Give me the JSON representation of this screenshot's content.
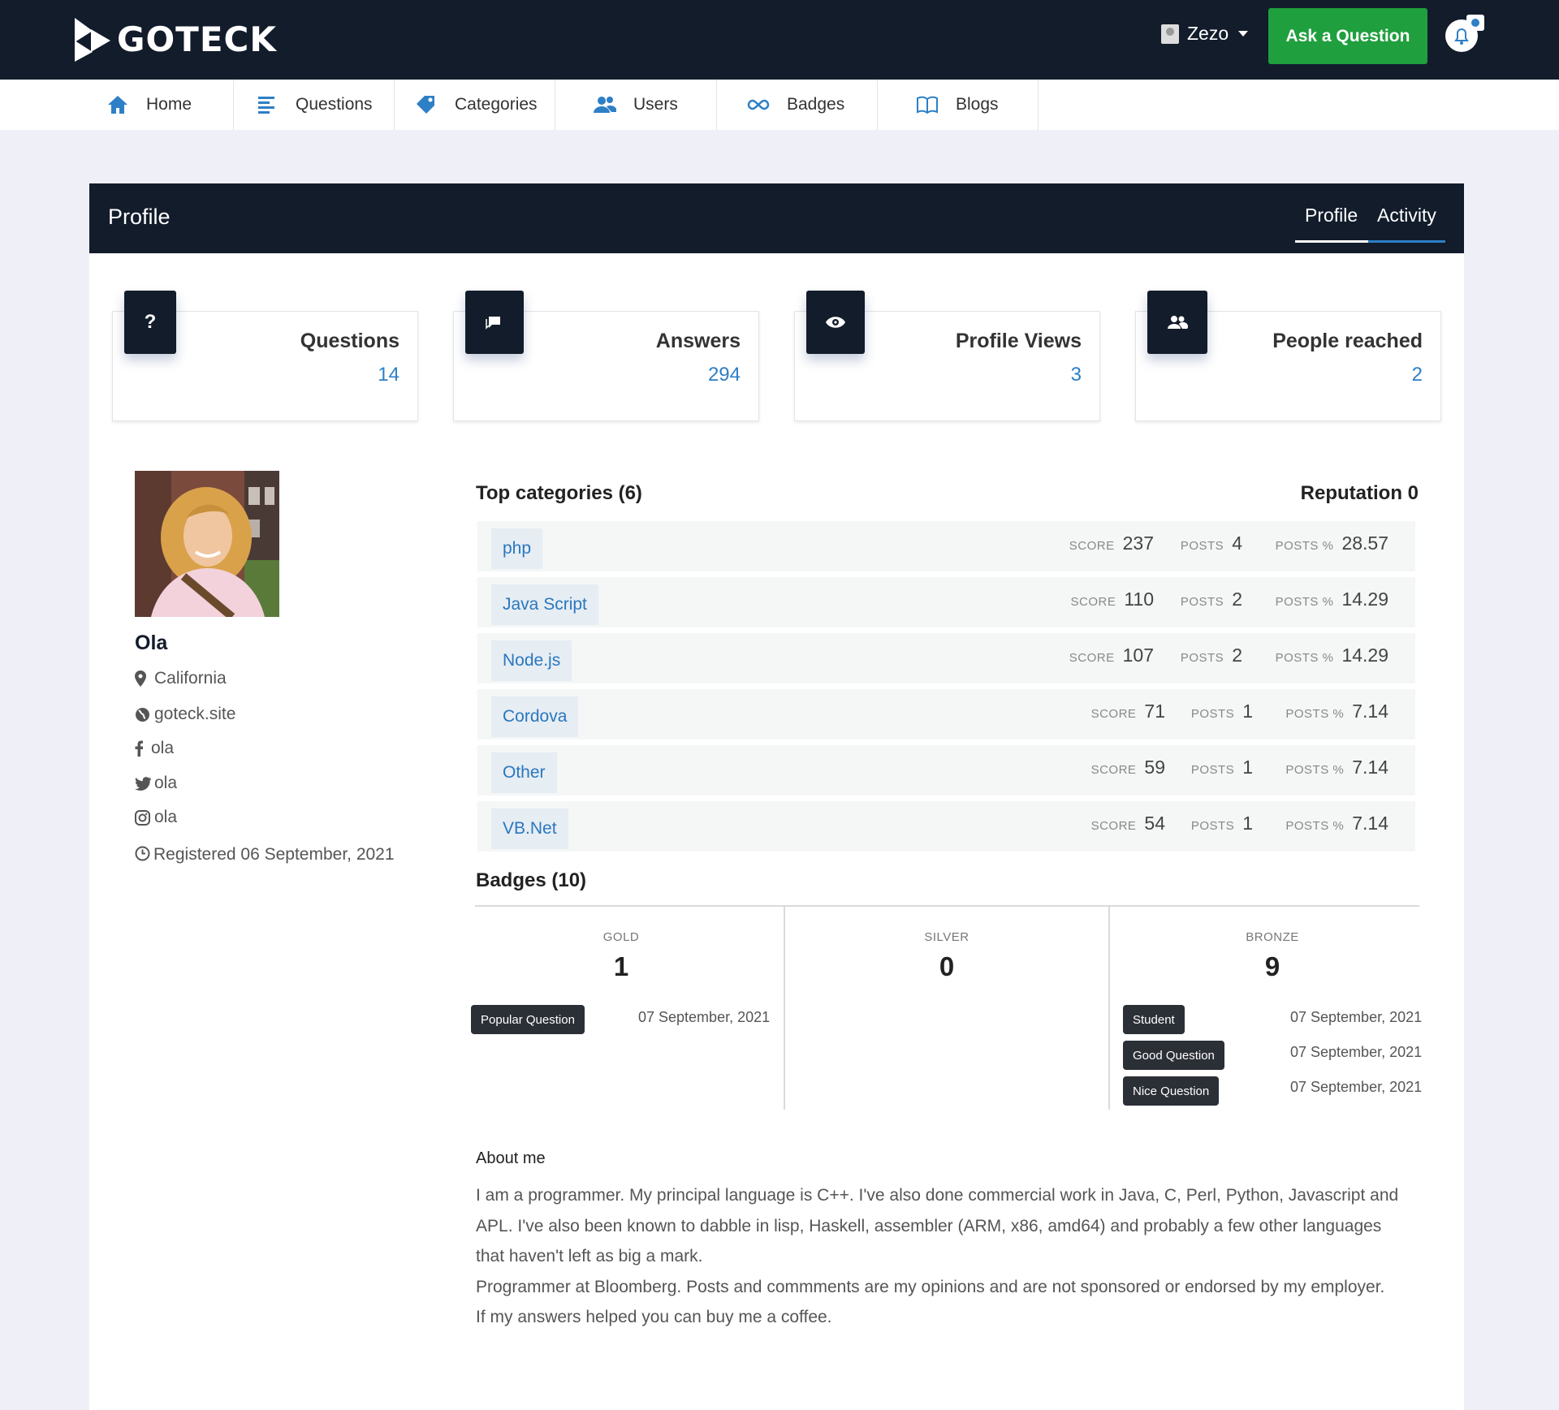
{
  "brand": {
    "name": "GOTECK"
  },
  "header": {
    "user_name": "Zezo",
    "ask_button": "Ask a Question",
    "icons": {
      "user": "user-avatar-icon",
      "dropdown": "chevron-down-icon",
      "notifications": "bell-icon"
    }
  },
  "nav": {
    "items": [
      {
        "label": "Home",
        "icon": "home-icon"
      },
      {
        "label": "Questions",
        "icon": "list-icon"
      },
      {
        "label": "Categories",
        "icon": "tag-icon"
      },
      {
        "label": "Users",
        "icon": "users-icon"
      },
      {
        "label": "Badges",
        "icon": "infinity-icon"
      },
      {
        "label": "Blogs",
        "icon": "book-icon"
      }
    ]
  },
  "profile_header": {
    "title": "Profile",
    "tabs": [
      {
        "label": "Profile",
        "active": true
      },
      {
        "label": "Activity",
        "active": false
      }
    ]
  },
  "stats": [
    {
      "label": "Questions",
      "value": "14",
      "icon": "question-icon"
    },
    {
      "label": "Answers",
      "value": "294",
      "icon": "chat-icon"
    },
    {
      "label": "Profile Views",
      "value": "3",
      "icon": "eye-icon"
    },
    {
      "label": "People reached",
      "value": "2",
      "icon": "people-icon"
    }
  ],
  "user": {
    "name": "Ola",
    "location": "California",
    "website": "goteck.site",
    "facebook": "ola",
    "twitter": "ola",
    "instagram": "ola",
    "registered": "Registered 06 September, 2021"
  },
  "categories": {
    "title": "Top categories (6)",
    "reputation": "Reputation 0",
    "labels": {
      "score": "SCORE",
      "posts": "POSTS",
      "posts_pct": "POSTS %"
    },
    "rows": [
      {
        "name": "php",
        "score": "237",
        "posts": "4",
        "posts_pct": "28.57"
      },
      {
        "name": "Java Script",
        "score": "110",
        "posts": "2",
        "posts_pct": "14.29"
      },
      {
        "name": "Node.js",
        "score": "107",
        "posts": "2",
        "posts_pct": "14.29"
      },
      {
        "name": "Cordova",
        "score": "71",
        "posts": "1",
        "posts_pct": "7.14"
      },
      {
        "name": "Other",
        "score": "59",
        "posts": "1",
        "posts_pct": "7.14"
      },
      {
        "name": "VB.Net",
        "score": "54",
        "posts": "1",
        "posts_pct": "7.14"
      }
    ]
  },
  "badges": {
    "title": "Badges (10)",
    "gold": {
      "label": "GOLD",
      "count": "1",
      "items": [
        {
          "name": "Popular Question",
          "date": "07 September, 2021"
        }
      ]
    },
    "silver": {
      "label": "SILVER",
      "count": "0",
      "items": []
    },
    "bronze": {
      "label": "BRONZE",
      "count": "9",
      "items": [
        {
          "name": "Student",
          "date": "07 September, 2021"
        },
        {
          "name": "Good Question",
          "date": "07 September, 2021"
        },
        {
          "name": "Nice Question",
          "date": "07 September, 2021"
        }
      ]
    }
  },
  "about": {
    "title": "About me",
    "lines": [
      "I am a programmer. My principal language is C++. I've also done commercial work in Java, C, Perl, Python, Javascript and APL. I've also been known to dabble in lisp, Haskell, assembler (ARM, x86, amd64) and probably a few other languages that haven't left as big a mark.",
      "Programmer at Bloomberg. Posts and commments are my opinions and are not sponsored or endorsed by my employer.",
      "If my answers helped you can buy me a coffee."
    ]
  },
  "colors": {
    "dark": "#121c2b",
    "accent_green": "#1f9f3e",
    "link_blue": "#2d7fc6",
    "tab_underline": "#2d7fc6"
  }
}
